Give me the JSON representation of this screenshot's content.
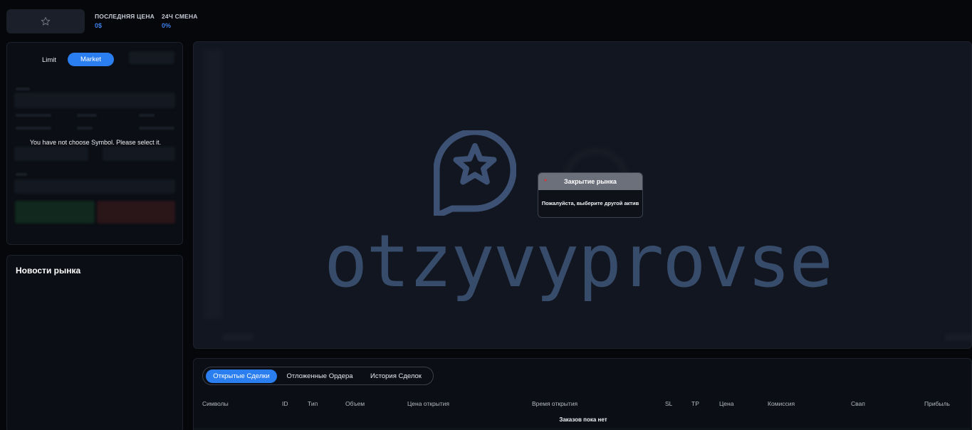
{
  "header": {
    "last_price_label": "ПОСЛЕДНЯЯ ЦЕНА",
    "last_price_value": "0$",
    "change_label": "24Ч СМЕНА",
    "change_value": "0%",
    "favorite_icon": "star-outline-icon"
  },
  "order_panel": {
    "tab_limit": "Limit",
    "tab_market": "Market",
    "active_tab": "Market",
    "no_symbol_message": "You have not choose Symbol. Please select it."
  },
  "news": {
    "title": "Новости рынка"
  },
  "watermark": {
    "text": "otzyvyprovse",
    "logo_icon": "chat-star-logo-icon"
  },
  "modal": {
    "title": "Закрытие рынка",
    "message": "Пожалуйста, выберите другой актив",
    "close_icon": "close-icon"
  },
  "orders": {
    "tabs": [
      {
        "label": "Открытые Сделки"
      },
      {
        "label": "Отложенные Ордера"
      },
      {
        "label": "История Сделок"
      }
    ],
    "active_tab": "Открытые Сделки",
    "columns": [
      "Символы",
      "ID",
      "Тип",
      "Объем",
      "Цена открытия",
      "Время открытия",
      "SL",
      "TP",
      "Цена",
      "Комиссия",
      "Свап",
      "Прибыль"
    ],
    "empty_message": "Заказов пока нет"
  },
  "colors": {
    "accent": "#2b7ef0",
    "background": "#05070b",
    "panel": "#0b0e14",
    "watermark": "#3c5173"
  }
}
